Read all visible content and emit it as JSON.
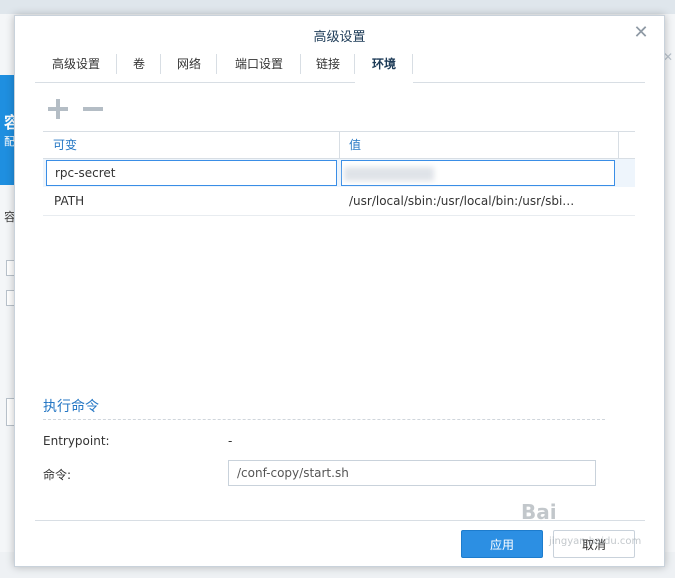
{
  "dialog": {
    "title": "高级设置",
    "close_icon": "close-icon"
  },
  "tabs": [
    {
      "label": "高级设置",
      "active": false
    },
    {
      "label": "卷",
      "active": false
    },
    {
      "label": "网络",
      "active": false
    },
    {
      "label": "端口设置",
      "active": false
    },
    {
      "label": "链接",
      "active": false
    },
    {
      "label": "环境",
      "active": true
    }
  ],
  "toolbar": {
    "add_icon": "plus-icon",
    "remove_icon": "minus-icon"
  },
  "env_table": {
    "columns": [
      "可变",
      "值"
    ],
    "rows": [
      {
        "variable": "rpc-secret",
        "value": "",
        "editing": true
      },
      {
        "variable": "PATH",
        "value": "/usr/local/sbin:/usr/local/bin:/usr/sbi…",
        "editing": false
      }
    ]
  },
  "exec": {
    "section_title": "执行命令",
    "entrypoint_label": "Entrypoint:",
    "entrypoint_value": "-",
    "command_label": "命令:",
    "command_value": "/conf-copy/start.sh"
  },
  "buttons": {
    "apply": "应用",
    "cancel": "取消"
  },
  "watermark": {
    "text": "Bai",
    "sub": "jingyan.baidu.com"
  },
  "colors": {
    "accent": "#2c8fe3",
    "header_text": "#2577c4",
    "focus_border": "#3a8ee6"
  }
}
